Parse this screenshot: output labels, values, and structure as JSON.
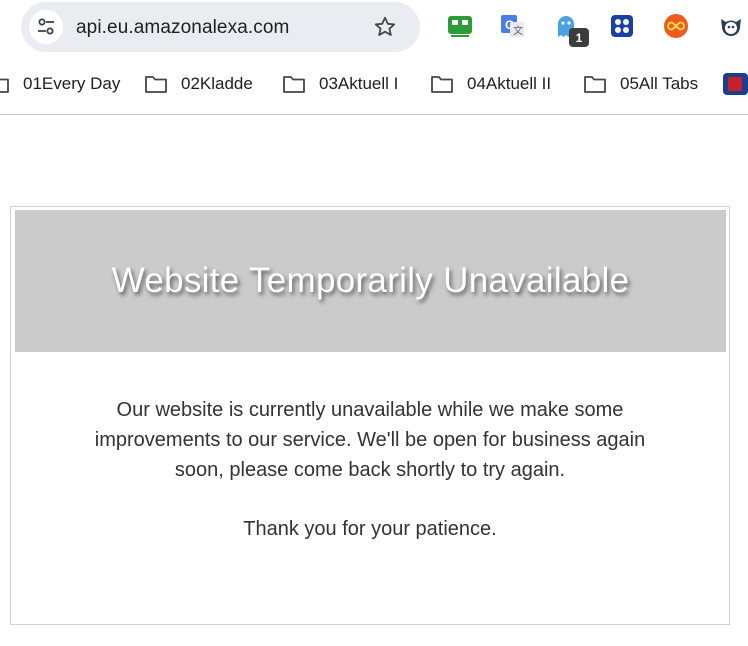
{
  "browser": {
    "omnibox": {
      "url": "api.eu.amazonalexa.com",
      "site_info_icon": "tune-icon",
      "bookmark_star_icon": "star-icon"
    },
    "extensions": [
      {
        "name": "roboform-icon",
        "color": "#2e9b3a"
      },
      {
        "name": "google-translate-icon",
        "color": "#4a7be8"
      },
      {
        "name": "ghostery-icon",
        "color": "#4aa3e0",
        "badge": "1"
      },
      {
        "name": "grid-extension-icon",
        "color": "#1b3fa5"
      },
      {
        "name": "infinity-extension-icon",
        "color": "#f05a1c"
      },
      {
        "name": "cat-extension-icon",
        "color": "#2a3d55"
      }
    ],
    "bookmarks": [
      {
        "label": "01Every Day"
      },
      {
        "label": "02Kladde"
      },
      {
        "label": "03Aktuell I"
      },
      {
        "label": "04Aktuell II"
      },
      {
        "label": "05All Tabs"
      }
    ]
  },
  "page": {
    "banner_title": "Website Temporarily Unavailable",
    "message_line1": "Our website is currently unavailable while we make some",
    "message_line2": "improvements to our service. We'll be open for business again",
    "message_line3": "soon, please come back shortly to try again.",
    "thanks": "Thank you for your patience.",
    "banner_color": "#cbcbcb"
  }
}
